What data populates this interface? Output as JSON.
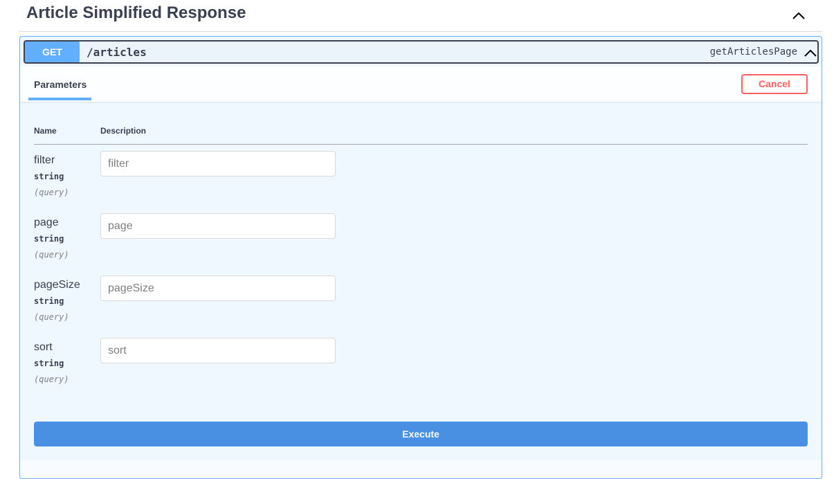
{
  "section": {
    "title": "Article Simplified Response"
  },
  "operation": {
    "method": "GET",
    "path": "/articles",
    "operation_id": "getArticlesPage"
  },
  "tabs": {
    "parameters_label": "Parameters",
    "cancel_label": "Cancel"
  },
  "table": {
    "headers": [
      "Name",
      "Description"
    ]
  },
  "parameters": [
    {
      "name": "filter",
      "type": "string",
      "in": "(query)",
      "placeholder": "filter"
    },
    {
      "name": "page",
      "type": "string",
      "in": "(query)",
      "placeholder": "page"
    },
    {
      "name": "pageSize",
      "type": "string",
      "in": "(query)",
      "placeholder": "pageSize"
    },
    {
      "name": "sort",
      "type": "string",
      "in": "(query)",
      "placeholder": "sort"
    }
  ],
  "execute_label": "Execute",
  "colors": {
    "get_accent": "#61affe",
    "execute": "#4990e2",
    "cancel": "#ff6060",
    "text": "#3b4151"
  },
  "icons": {
    "section_toggle": "chevron-up-icon",
    "summary_toggle": "chevron-up-icon"
  }
}
